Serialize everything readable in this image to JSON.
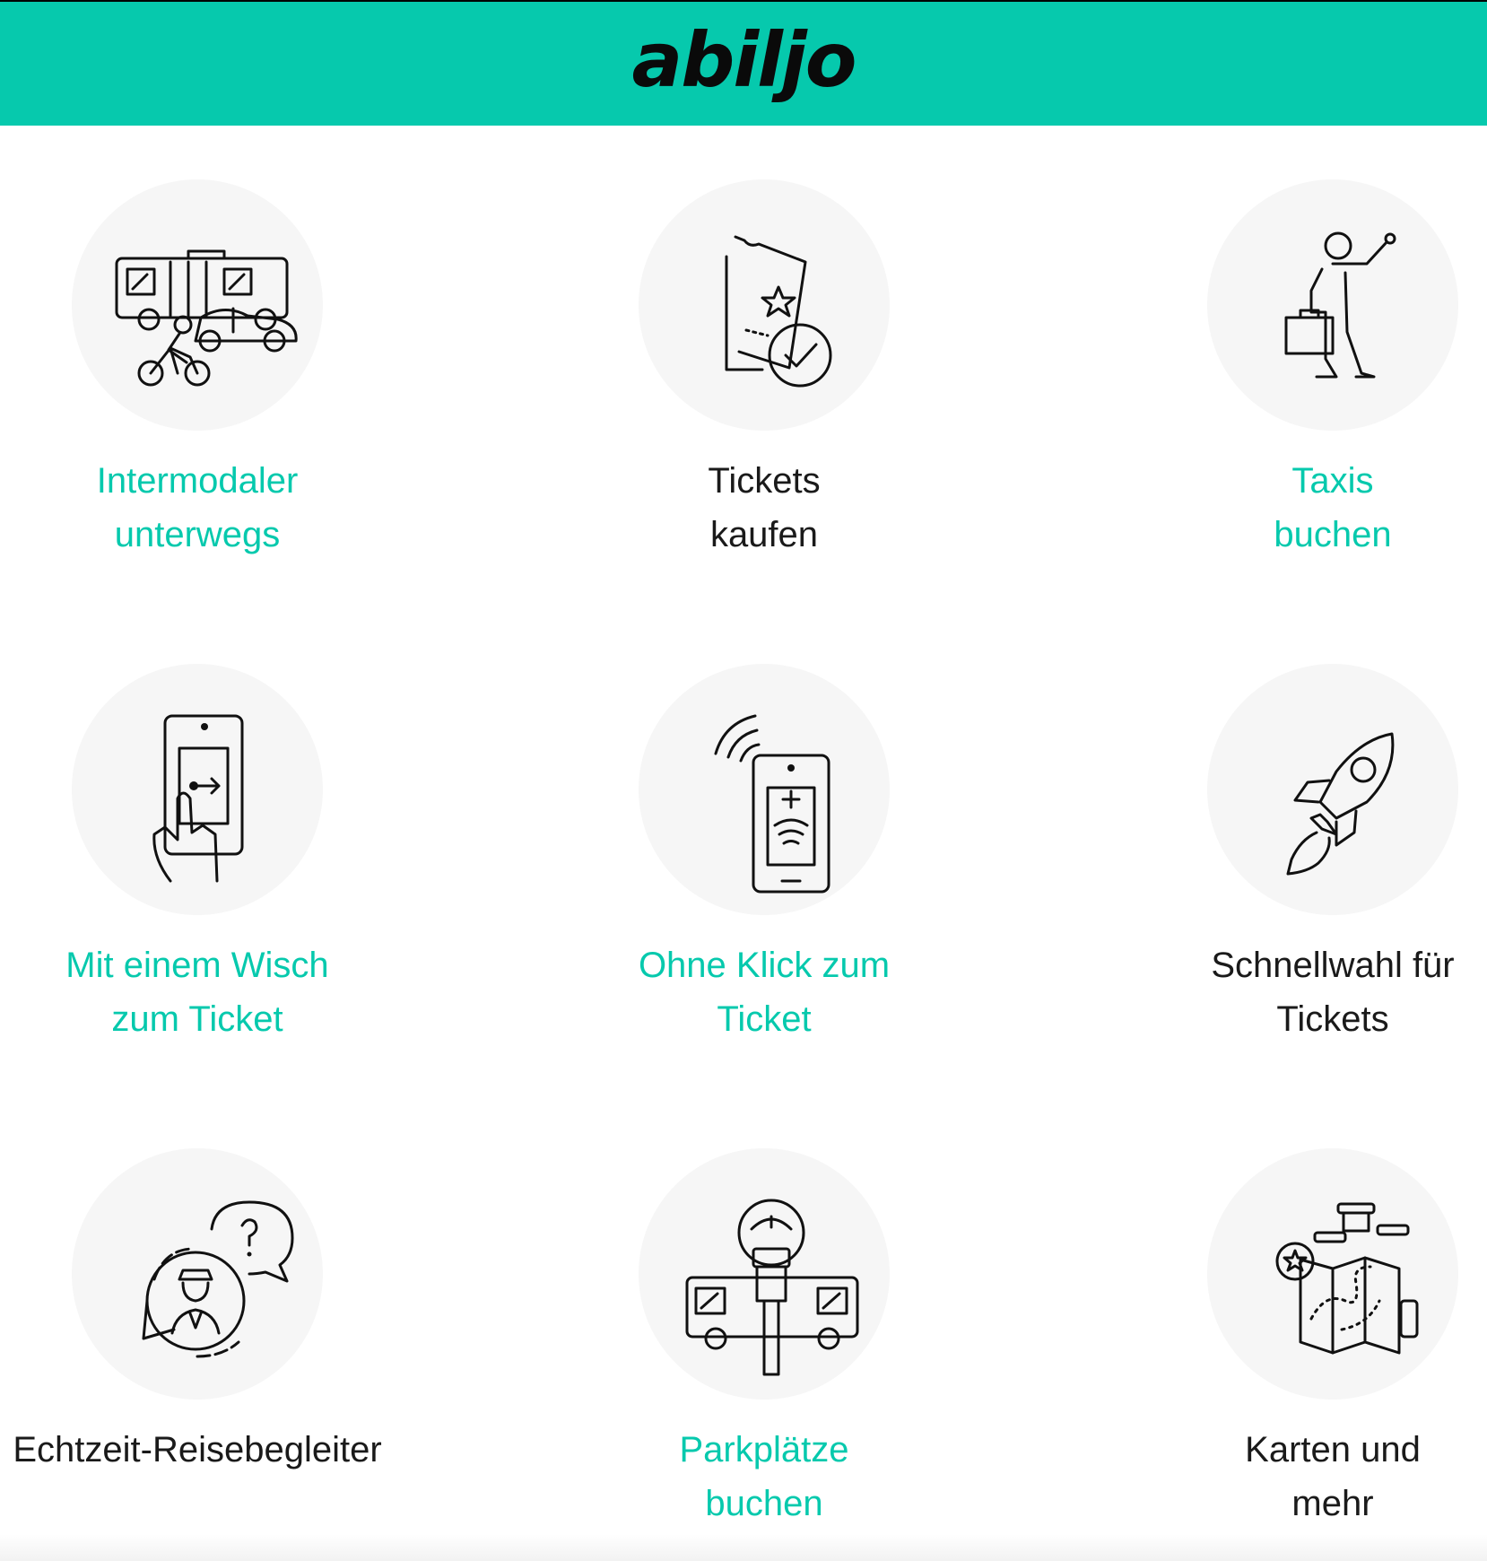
{
  "header": {
    "logo_text": "abiljo",
    "color": "#06c9ad"
  },
  "colors": {
    "accent": "#06c9ad",
    "text": "#1a1a1a",
    "circle": "#f6f6f6"
  },
  "features": [
    {
      "icon": "intermodal-transport-icon",
      "line1": "Intermodaler",
      "line2": "unterwegs",
      "link": true
    },
    {
      "icon": "ticket-check-icon",
      "line1": "Tickets",
      "line2": "kaufen",
      "link": false
    },
    {
      "icon": "hail-taxi-icon",
      "line1": "Taxis",
      "line2": "buchen",
      "link": true
    },
    {
      "icon": "swipe-ticket-icon",
      "line1": "Mit einem Wisch",
      "line2": "zum Ticket",
      "link": true
    },
    {
      "icon": "contactless-phone-icon",
      "line1": "Ohne Klick zum",
      "line2": "Ticket",
      "link": true
    },
    {
      "icon": "rocket-icon",
      "line1": "Schnellwahl für",
      "line2": "Tickets",
      "link": false
    },
    {
      "icon": "travel-assistant-chat-icon",
      "line1": "Echtzeit-Reisebegleiter",
      "line2": "",
      "link": false
    },
    {
      "icon": "park-and-ride-icon",
      "line1": "Parkplätze",
      "line2": "buchen",
      "link": true
    },
    {
      "icon": "city-map-icon",
      "line1": "Karten und",
      "line2": "mehr",
      "link": false
    }
  ]
}
